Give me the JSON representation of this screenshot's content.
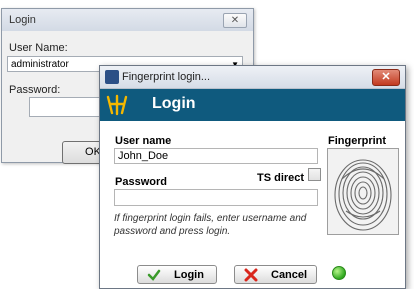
{
  "background_dialog": {
    "title": "Login",
    "close_glyph": "✕",
    "user_label": "User Name:",
    "user_value": "administrator",
    "password_label": "Password:",
    "ok_label": "OK"
  },
  "fingerprint_dialog": {
    "title": "Fingerprint login...",
    "close_glyph": "✕",
    "header_title": "Login",
    "user_label": "User name",
    "user_value": "John_Doe",
    "password_label": "Password",
    "ts_direct_label": "TS direct",
    "ts_direct_checked": false,
    "hint": "If fingerprint login fails, enter username and password and press login.",
    "fingerprint_label": "Fingerprint",
    "login_label": "Login",
    "cancel_label": "Cancel",
    "status_color": "#2fa81f"
  },
  "colors": {
    "header": "#0f5a7e",
    "close_red": "#c23a20"
  },
  "icons": [
    "close-icon",
    "app-icon",
    "logo-icon",
    "fingerprint-icon",
    "checkmark-icon",
    "cancel-x-icon",
    "dropdown-arrow-icon",
    "status-led-icon"
  ]
}
